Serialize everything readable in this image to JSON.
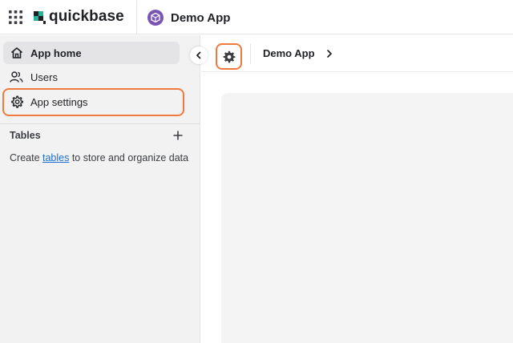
{
  "header": {
    "brand": "quickbase",
    "app_name": "Demo App",
    "app_badge_color": "#7a56b4",
    "icons": {
      "grid": "grid-icon",
      "logo": "quickbase-logo-icon",
      "app": "hexagon-app-icon"
    }
  },
  "sidebar": {
    "items": [
      {
        "label": "App home",
        "icon": "home-icon",
        "active": true
      },
      {
        "label": "Users",
        "icon": "users-icon",
        "active": false
      },
      {
        "label": "App settings",
        "icon": "gear-icon",
        "active": false
      }
    ],
    "tables": {
      "title": "Tables",
      "hint_prefix": "Create ",
      "hint_link": "tables",
      "hint_suffix": " to store and organize data"
    }
  },
  "main": {
    "breadcrumb": "Demo App"
  },
  "colors": {
    "highlight": "#f07a3e",
    "link": "#1f6fd0",
    "sidebar_bg": "#f2f2f3"
  }
}
